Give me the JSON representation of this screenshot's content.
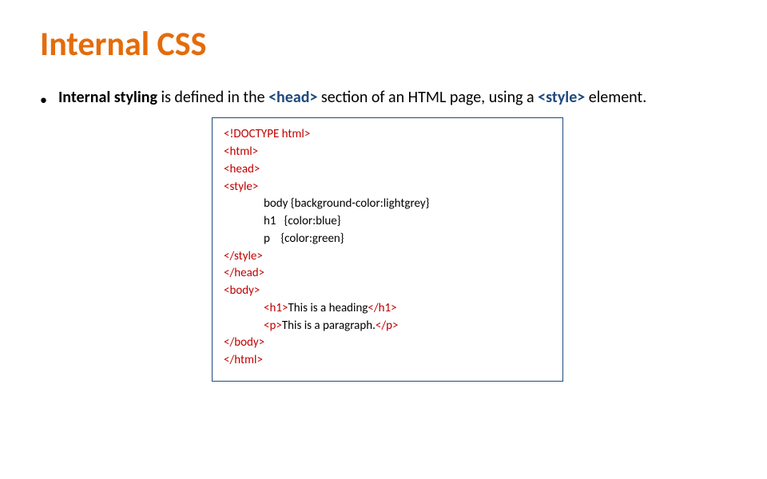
{
  "title": "Internal CSS",
  "bullet": {
    "lead_bold": "Internal styling",
    "text1": " is defined in the ",
    "tag_head": "<head>",
    "text2": " section of an HTML page, using a ",
    "tag_style": "<style>",
    "text3": " element."
  },
  "code": {
    "l1": "<!DOCTYPE html>",
    "l2": "<html>",
    "l3": "<head>",
    "l4": "<style>",
    "l5": "body {background-color:lightgrey}",
    "l6": "h1   {color:blue}",
    "l7": "p    {color:green}",
    "l8": "</style>",
    "l9": "</head>",
    "l10": "<body>",
    "l11_a": "<h1>",
    "l11_b": "This is a heading",
    "l11_c": "</h1>",
    "l12_a": "<p>",
    "l12_b": "This is a paragraph.",
    "l12_c": "</p>",
    "l13": "</body>",
    "l14": "</html>"
  }
}
